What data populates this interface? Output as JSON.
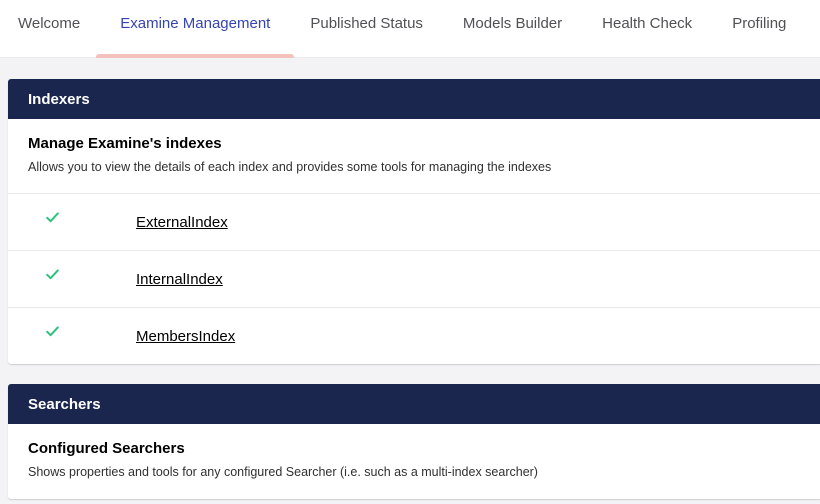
{
  "tabs": [
    {
      "label": "Welcome",
      "active": false
    },
    {
      "label": "Examine Management",
      "active": true
    },
    {
      "label": "Published Status",
      "active": false
    },
    {
      "label": "Models Builder",
      "active": false
    },
    {
      "label": "Health Check",
      "active": false
    },
    {
      "label": "Profiling",
      "active": false
    }
  ],
  "indexers": {
    "header": "Indexers",
    "title": "Manage Examine's indexes",
    "description": "Allows you to view the details of each index and provides some tools for managing the indexes",
    "items": [
      {
        "name": "ExternalIndex",
        "status_icon": "check-icon"
      },
      {
        "name": "InternalIndex",
        "status_icon": "check-icon"
      },
      {
        "name": "MembersIndex",
        "status_icon": "check-icon"
      }
    ]
  },
  "searchers": {
    "header": "Searchers",
    "title": "Configured Searchers",
    "description": "Shows properties and tools for any configured Searcher (i.e. such as a multi-index searcher)"
  },
  "colors": {
    "header_bg": "#1b264f",
    "active_tab": "#3544b1",
    "active_indicator": "#f5c1bc",
    "check": "#2bc37c"
  }
}
